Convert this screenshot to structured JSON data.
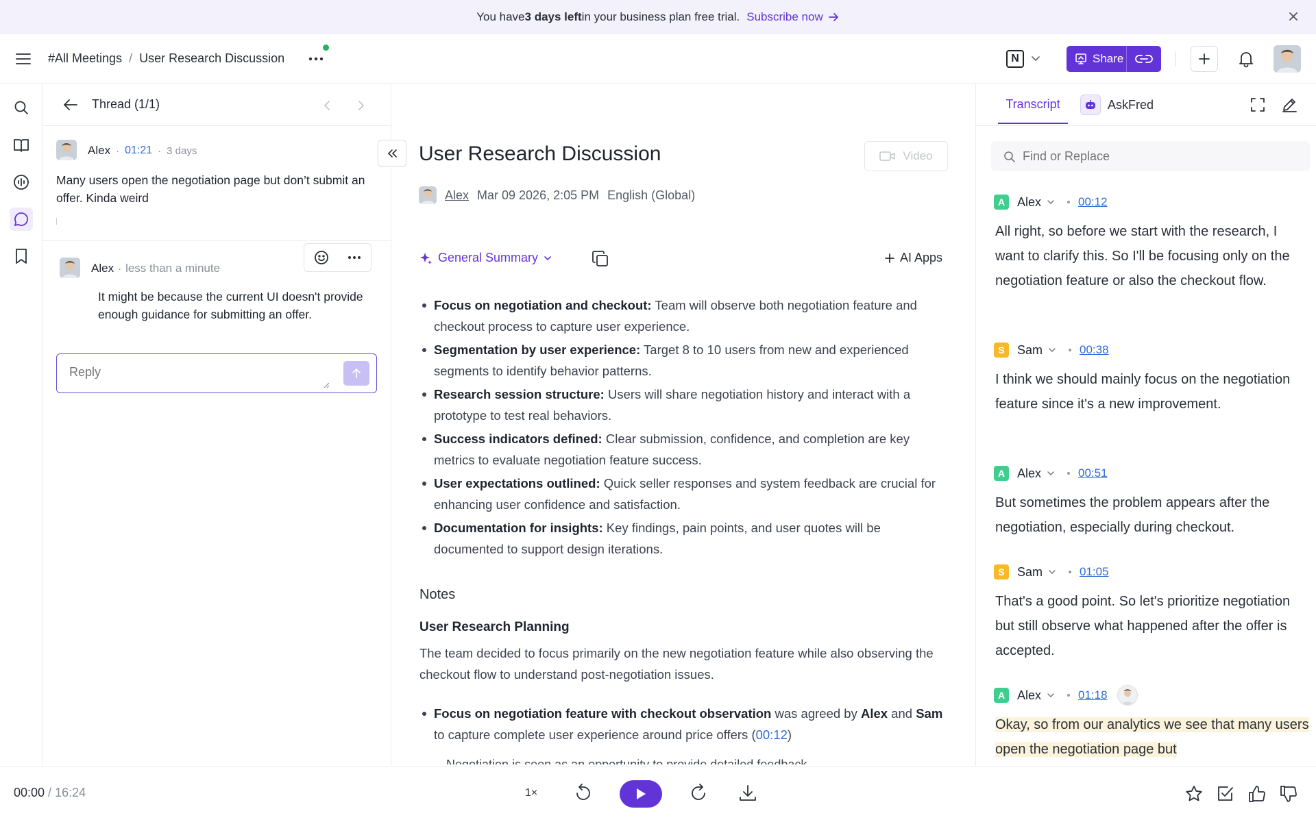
{
  "banner": {
    "prefix": "You have ",
    "bold": "3 days left",
    "suffix": " in your business plan free trial.",
    "cta": "Subscribe now"
  },
  "header": {
    "breadcrumb_root": "#All Meetings",
    "breadcrumb_sep": "/",
    "breadcrumb_current": "User Research Discussion",
    "notion_letter": "N",
    "share_label": "Share"
  },
  "thread": {
    "title": "Thread (1/1)",
    "root": {
      "author": "Alex",
      "timestamp": "01:21",
      "age": "3 days",
      "text": "Many users open the negotiation page but don’t submit an offer. Kinda weird"
    },
    "reply": {
      "author": "Alex",
      "age": "less than a minute",
      "text": "It might be because the current UI doesn't provide enough guidance for submitting an offer."
    },
    "reply_placeholder": "Reply"
  },
  "main": {
    "title": "User Research Discussion",
    "video_label": "Video",
    "author": "Alex",
    "date": "Mar 09 2026, 2:05 PM",
    "language": "English (Global)",
    "summary_label": "General Summary",
    "ai_apps_label": "AI Apps",
    "bullets": [
      {
        "bold": "Focus on negotiation and checkout:",
        "text": " Team will observe both negotiation feature and checkout process to capture user experience."
      },
      {
        "bold": "Segmentation by user experience:",
        "text": " Target 8 to 10 users from new and experienced segments to identify behavior patterns."
      },
      {
        "bold": "Research session structure:",
        "text": " Users will share negotiation history and interact with a prototype to test real behaviors."
      },
      {
        "bold": "Success indicators defined:",
        "text": " Clear submission, confidence, and completion are key metrics to evaluate negotiation feature success."
      },
      {
        "bold": "User expectations outlined:",
        "text": " Quick seller responses and system feedback are crucial for enhancing user confidence and satisfaction."
      },
      {
        "bold": "Documentation for insights:",
        "text": " Key findings, pain points, and user quotes will be documented to support design iterations."
      }
    ],
    "notes_heading": "Notes",
    "plan_heading": "User Research Planning",
    "plan_text": "The team decided to focus primarily on the new negotiation feature while also observing the checkout flow to understand post-negotiation issues.",
    "note_item": {
      "bold1": "Focus on negotiation feature with checkout observation",
      "t1": " was agreed by ",
      "bold2": "Alex",
      "t2": " and ",
      "bold3": "Sam",
      "t3": " to capture complete user experience around price offers (",
      "link": "00:12",
      "t4": ")"
    },
    "cut_line": "Negotiation is seen as an opportunity to provide detailed feedback"
  },
  "transcript": {
    "tab_transcript": "Transcript",
    "tab_askfred": "AskFred",
    "find_placeholder": "Find or Replace",
    "entries": [
      {
        "initial": "A",
        "speaker": "Alex",
        "time": "00:12",
        "color": "#3ecf8e",
        "text": "All right, so before we start with the research, I want to clarify this. So I'll be focusing only on the negotiation feature or also the checkout flow."
      },
      {
        "initial": "S",
        "speaker": "Sam",
        "time": "00:38",
        "color": "#f7b924",
        "text": "I think we should mainly focus on the negotiation feature since it's a new improvement."
      },
      {
        "initial": "A",
        "speaker": "Alex",
        "time": "00:51",
        "color": "#3ecf8e",
        "text": "But sometimes the problem appears after the negotiation, especially during checkout."
      },
      {
        "initial": "S",
        "speaker": "Sam",
        "time": "01:05",
        "color": "#f7b924",
        "text": "That's a good point. So let's prioritize negotiation but still observe what happened after the offer is accepted."
      },
      {
        "initial": "A",
        "speaker": "Alex",
        "time": "01:18",
        "color": "#3ecf8e",
        "text": "Okay, so from our analytics we see that many users open the negotiation page but"
      }
    ]
  },
  "footer": {
    "current": "00:00",
    "sep": " / ",
    "duration": "16:24",
    "speed": "1×"
  },
  "colors": {
    "accent": "#6234d8",
    "link": "#2f6bd8"
  }
}
